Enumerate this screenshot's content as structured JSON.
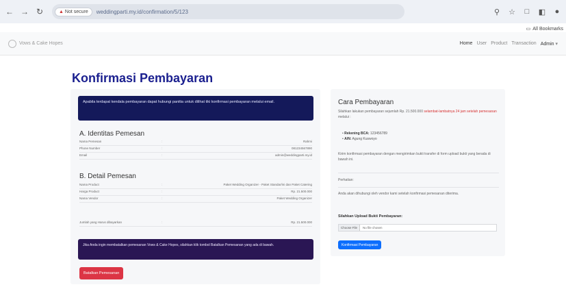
{
  "browser": {
    "not_secure": "Not secure",
    "url": "weddingparti.my.id/confirmation/5/123",
    "bookmarks_label": "All Bookmarks"
  },
  "nav": {
    "brand": "Vows & Cake Hopes",
    "menu": [
      "Home",
      "User",
      "Product",
      "Transaction",
      "Admin"
    ]
  },
  "page": {
    "title": "Konfirmasi Pembayaran"
  },
  "left": {
    "alert": "Apabila terdapat kendala pembayaran dapat hubungi panitia untuk dilihat tiki konfirmasi pembayaran melalui email.",
    "section_a": "A. Identitas Pemesan",
    "rows_a": [
      {
        "k": "Nama Pemesan",
        "v": "Rahmi"
      },
      {
        "k": "Phone Number",
        "v": "081234567890"
      },
      {
        "k": "Email",
        "v": "admin@weddingparti.my.id"
      }
    ],
    "section_b": "B. Detail Pemesan",
    "rows_b": [
      {
        "k": "Nama Product",
        "v": "Paket Wedding Organizer - Paket Standar/ini dan Paket Catering"
      },
      {
        "k": "Harga Product",
        "v": "Rp. 21.500.000"
      },
      {
        "k": "Nama Vendor",
        "v": "Paket Wedding Organizer"
      }
    ],
    "total_label": "Jumlah yang Harus dibayarkan",
    "total_value": "Rp. 21.500.000",
    "purple_alert": "Jika Anda ingin membatalkan pemesanan Vows & Cake Hopes, silahkan klik tombol Batalkan Pemesanan yang ada di bawah.",
    "cancel_button": "Batalkan Pemesanan"
  },
  "right": {
    "title": "Cara Pembayaran",
    "intro": "Silahkan lakukan pembayaran sejumlah Rp. 21.500.000",
    "intro_red": "selambat-lambatnya 24 jam setelah pemesanan",
    "intro_tail": "melalui :",
    "bank_label": "Rekening BCA:",
    "bank_value": "123456789",
    "holder_label": "A/N:",
    "holder_value": "Agung Kuswoyo",
    "note": "Kirim konfirmasi pembayaran dengan mengirimkan bukti transfer di form upload bukti yang berada di bawah ini.",
    "warning_title": "Perhatian:",
    "warning": "Anda akan dihubungi oleh vendor kami setelah konfirmasi pemesanan diterima.",
    "upload_label": "Silahkan Upload Bukti Pembayaran:",
    "choose_file": "Choose File",
    "no_file": "No file chosen",
    "submit": "Konfirmasi Pembayaran"
  }
}
